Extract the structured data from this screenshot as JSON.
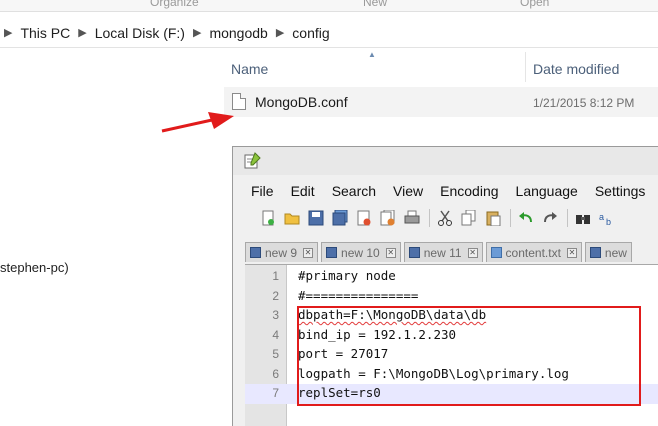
{
  "ribbon": {
    "labels": [
      "Organize",
      "New",
      "Open"
    ]
  },
  "address": {
    "crumbs": [
      "This PC",
      "Local Disk (F:)",
      "mongodb",
      "config"
    ]
  },
  "nav": {
    "visible_item": "stephen-pc)"
  },
  "file_list": {
    "columns": {
      "name": "Name",
      "date": "Date modified"
    },
    "files": [
      {
        "name": "MongoDB.conf",
        "date": "1/21/2015 8:12 PM"
      }
    ]
  },
  "notepadpp": {
    "menu": [
      "File",
      "Edit",
      "Search",
      "View",
      "Encoding",
      "Language",
      "Settings",
      "M"
    ],
    "tabs": [
      {
        "label": "new  9",
        "light": false
      },
      {
        "label": "new  10",
        "light": false
      },
      {
        "label": "new  11",
        "light": false
      },
      {
        "label": "content.txt",
        "light": true
      },
      {
        "label": "new",
        "light": false
      }
    ],
    "lines": [
      {
        "num": "1",
        "text": "#primary node"
      },
      {
        "num": "2",
        "text": "#==============="
      },
      {
        "num": "3",
        "text": "dbpath=F:\\MongoDB\\data\\db"
      },
      {
        "num": "4",
        "text": "bind_ip = 192.1.2.230"
      },
      {
        "num": "5",
        "text": "port = 27017"
      },
      {
        "num": "6",
        "text": "logpath = F:\\MongoDB\\Log\\primary.log"
      },
      {
        "num": "7",
        "text": "replSet=rs0"
      }
    ]
  },
  "colors": {
    "annotation": "#e11b1b",
    "current_line": "#e8e8ff"
  }
}
